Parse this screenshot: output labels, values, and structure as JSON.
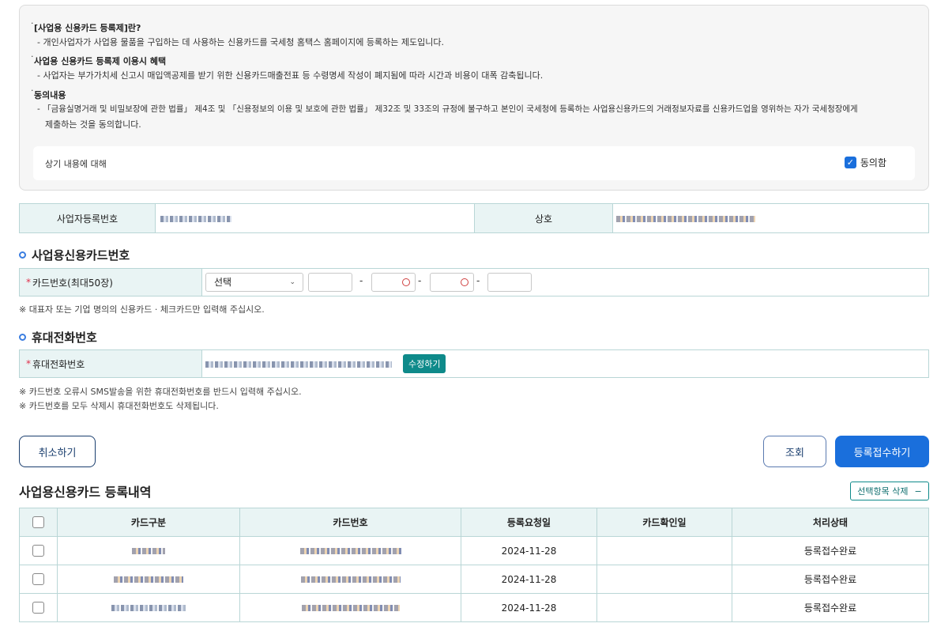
{
  "notice": {
    "s1_title": "[사업용 신용카드 등록제]란?",
    "s1_body": "- 개인사업자가 사업용 물품을 구입하는 데 사용하는 신용카드를 국세청 홈택스 홈페이지에 등록하는 제도입니다.",
    "s2_title": "사업용 신용카드 등록제 이용시 혜택",
    "s2_body": "- 사업자는 부가가치세 신고시 매입액공제를 받기 위한 신용카드매출전표 등 수령명세 작성이 폐지됨에 따라 시간과 비용이 대폭 감축됩니다.",
    "s3_title": "동의내용",
    "s3_body_line1": "- 「금융실명거래 및 비밀보장에 관한 법률」 제4조 및 「신용정보의 이용 및 보호에 관한 법률」 제32조 및 33조의 규정에 불구하고 본인이 국세청에 등록하는 사업용신용카드의   거래정보자료를 신용카드업을 영위하는 자가 국세청장에게",
    "s3_body_line2": "제출하는 것을 동의합니다.",
    "agree_prompt": "상기 내용에 대해",
    "agree_label": "동의함",
    "agree_checked": true
  },
  "business": {
    "reg_no_label": "사업자등록번호",
    "name_label": "상호"
  },
  "card_section": {
    "title": "사업용신용카드번호",
    "label": "카드번호(최대50장)",
    "select_value": "선택",
    "note": "※ 대표자 또는 기업 명의의 신용카드 · 체크카드만 입력해 주십시오."
  },
  "phone_section": {
    "title": "휴대전화번호",
    "label": "휴대전화번호",
    "edit_button": "수정하기",
    "note1": "※ 카드번호 오류시 SMS발송을 위한 휴대전화번호를 반드시 입력해 주십시오.",
    "note2": "※ 카드번호를 모두 삭제시 휴대전화번호도 삭제됩니다."
  },
  "actions": {
    "cancel": "취소하기",
    "lookup": "조회",
    "submit": "등록접수하기"
  },
  "list": {
    "title": "사업용신용카드 등록내역",
    "delete_selected": "선택항목 삭제",
    "columns": [
      "카드구분",
      "카드번호",
      "등록요청일",
      "카드확인일",
      "처리상태"
    ],
    "rows": [
      {
        "request_date": "2024-11-28",
        "confirm_date": "",
        "status": "등록접수완료"
      },
      {
        "request_date": "2024-11-28",
        "confirm_date": "",
        "status": "등록접수완료"
      },
      {
        "request_date": "2024-11-28",
        "confirm_date": "",
        "status": "등록접수완료"
      }
    ]
  },
  "colors": {
    "primary": "#1a6fdc",
    "teal": "#0e8a8a",
    "header_bg": "#e9f4f4",
    "border": "#b9d6d6",
    "required": "#e0304b"
  }
}
